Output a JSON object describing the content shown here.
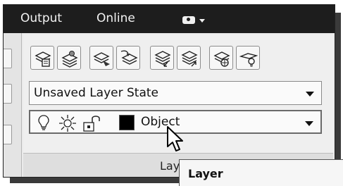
{
  "ribbon": {
    "tabs": [
      {
        "label": "Output"
      },
      {
        "label": "Online"
      }
    ],
    "tab_menu_icon": "camera-icon"
  },
  "layers_panel": {
    "title": "Layers",
    "tool_buttons": [
      {
        "icon": "layer-properties-icon"
      },
      {
        "icon": "layer-states-icon"
      },
      {
        "icon": "make-current-layer-icon"
      },
      {
        "icon": "match-layer-icon"
      },
      {
        "icon": "previous-layer-icon"
      },
      {
        "icon": "layer-isolate-icon"
      },
      {
        "icon": "layer-freeze-icon"
      },
      {
        "icon": "layer-off-icon"
      }
    ],
    "layer_state": {
      "value": "Unsaved Layer State"
    },
    "current_layer": {
      "value": "Object",
      "icons": [
        "lightbulb-on-icon",
        "sun-thawed-icon",
        "padlock-unlocked-icon"
      ],
      "color": "#000000"
    }
  },
  "tooltip": {
    "title": "Layer"
  }
}
